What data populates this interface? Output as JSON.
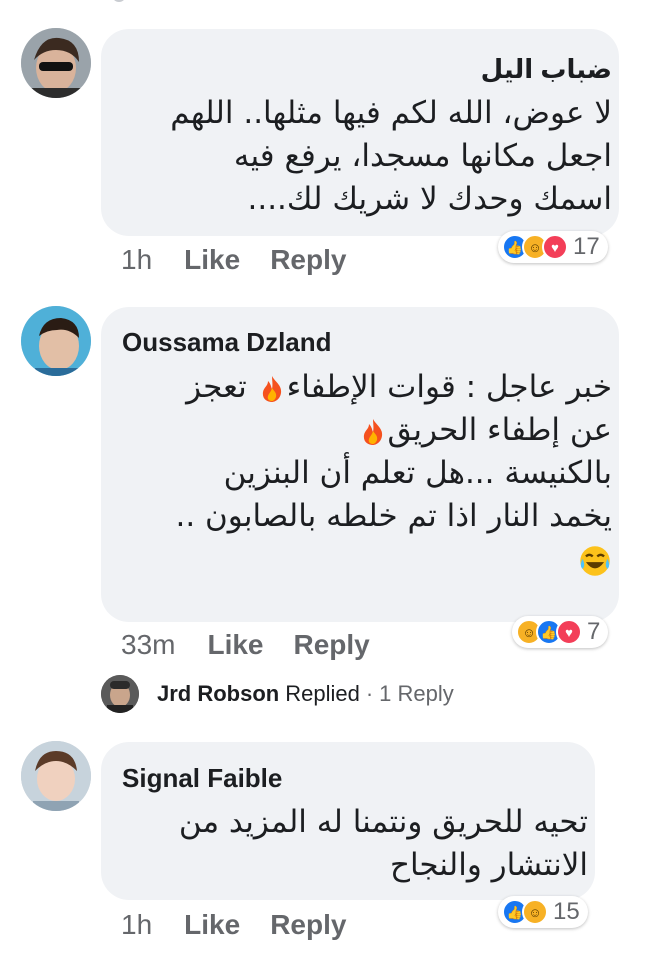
{
  "comments": [
    {
      "author": "ضباب اليل",
      "lines": [
        "لا عوض، الله لكم فيها مثلها.. اللهم",
        "اجعل مكانها مسجدا، يرفع فيه",
        "اسمك وحدك لا شريك لك...."
      ],
      "time": "1h",
      "like_label": "Like",
      "reply_label": "Reply",
      "reactions": [
        "like",
        "haha",
        "love"
      ],
      "reaction_count": "17"
    },
    {
      "author": "Oussama Dzland",
      "line1_a": "خبر عاجل : قوات الإطفاء",
      "line1_b": "تعجز",
      "line2": "عن إطفاء الحريق",
      "line3": "بالكنيسة ...هل تعلم أن البنزين",
      "line4": "يخمد النار اذا تم خلطه بالصابون ..",
      "time": "33m",
      "like_label": "Like",
      "reply_label": "Reply",
      "reactions": [
        "haha",
        "like",
        "love"
      ],
      "reaction_count": "7",
      "icons": [
        "fire-emoji",
        "laughing-tears-emoji"
      ]
    },
    {
      "author": "Signal Faible",
      "lines": [
        "تحيه للحريق ونتمنا له المزيد من",
        "الانتشار والنجاح"
      ],
      "time": "1h",
      "like_label": "Like",
      "reply_label": "Reply",
      "reactions": [
        "like",
        "haha"
      ],
      "reaction_count": "15"
    }
  ],
  "reply_summary": {
    "name": "Jrd Robson",
    "verb": "Replied",
    "separator": "·",
    "count_text": "1 Reply"
  },
  "colors": {
    "bubble": "#f0f2f5",
    "meta": "#65676b",
    "like": "#1877f2",
    "haha": "#f7b125",
    "love": "#f33e58"
  }
}
